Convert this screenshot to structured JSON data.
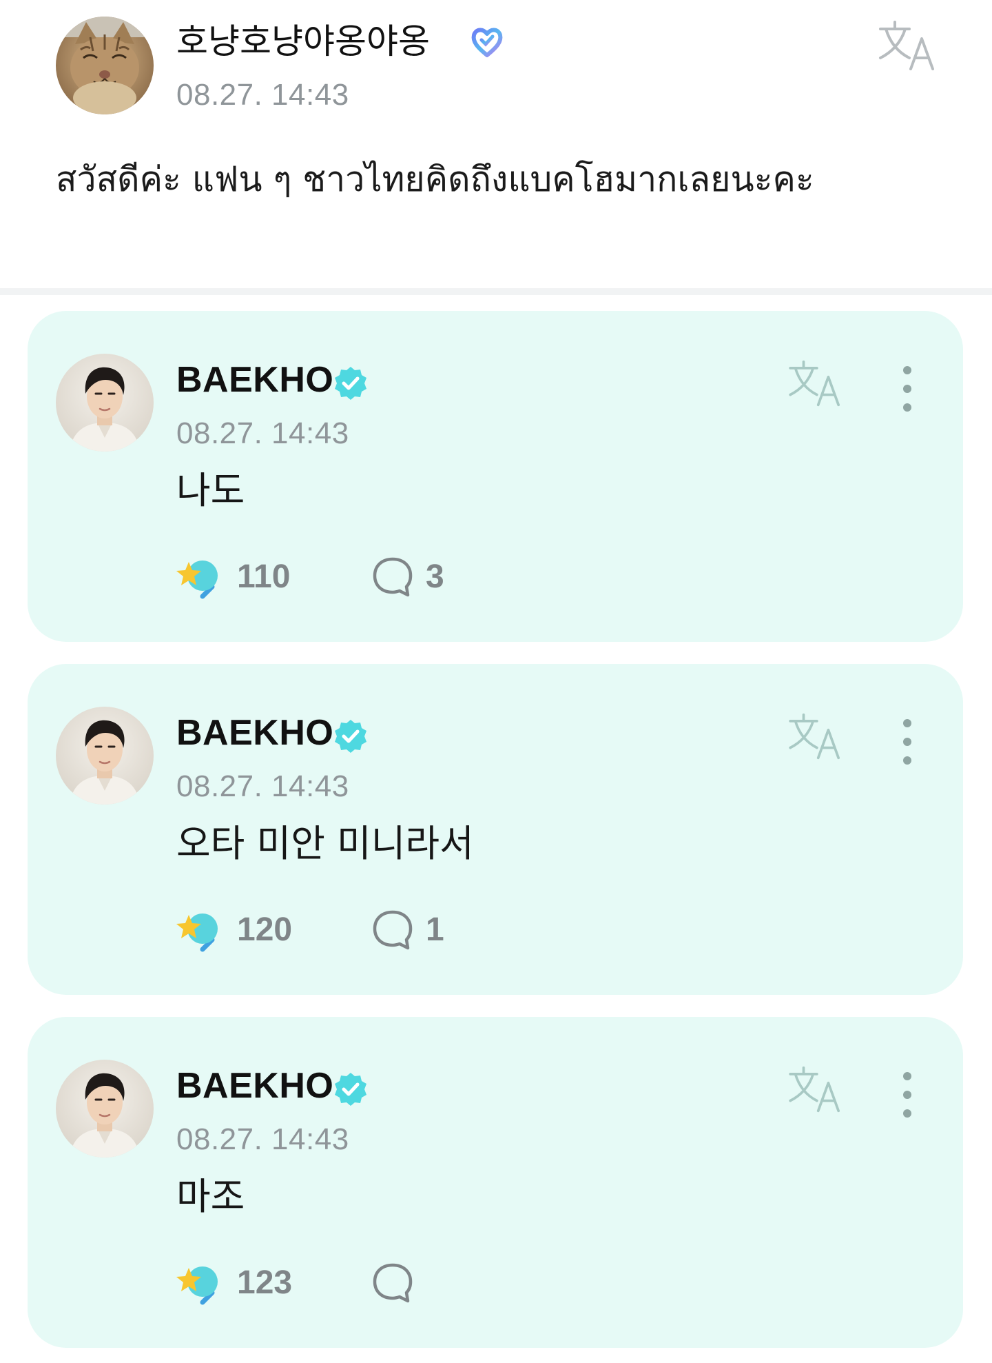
{
  "post": {
    "author_name": "호냥호냥야옹야옹",
    "timestamp": "08.27. 14:43",
    "body": "สวัสดีค่ะ แฟน ๆ ชาวไทยคิดถึงแบคโฮมากเลยนะคะ",
    "avatar_icon": "cat-avatar",
    "badge_icon": "fan-heart-badge-icon",
    "translate_icon": "translate-icon"
  },
  "comments": [
    {
      "author_name": "BAEKHO",
      "timestamp": "08.27. 14:43",
      "text": "나도",
      "likes": "110",
      "replies": "3"
    },
    {
      "author_name": "BAEKHO",
      "timestamp": "08.27. 14:43",
      "text": "오타 미안 미니라서",
      "likes": "120",
      "replies": "1"
    },
    {
      "author_name": "BAEKHO",
      "timestamp": "08.27. 14:43",
      "text": "마조",
      "likes": "123",
      "replies": ""
    }
  ],
  "colors": {
    "card_background": "#e6faf6",
    "verified_badge": "#4ed8e0",
    "muted_text": "#8f9599",
    "icon_gray": "#7f8588"
  }
}
